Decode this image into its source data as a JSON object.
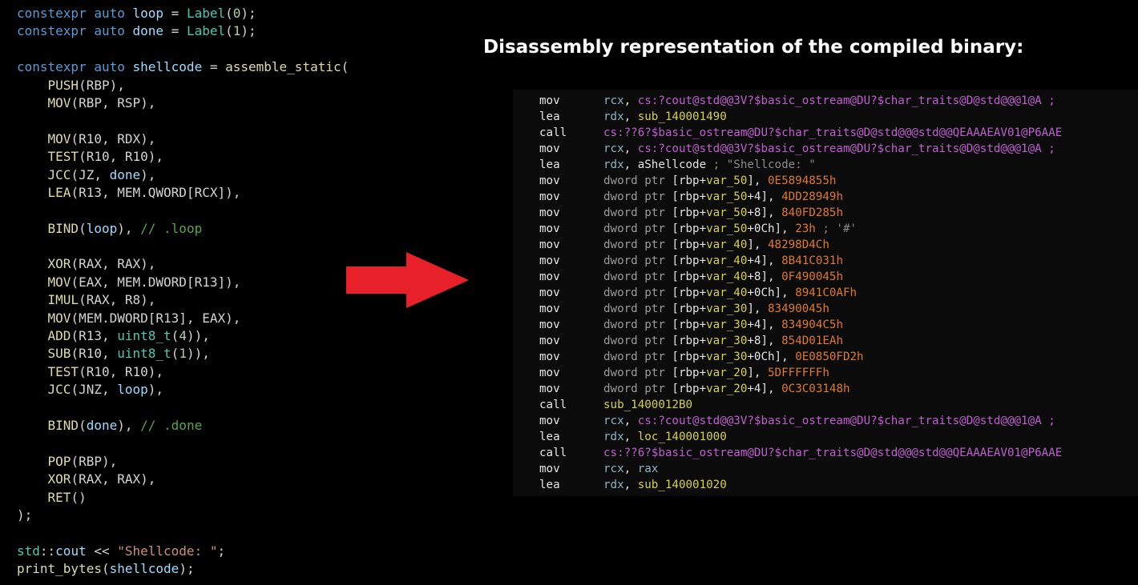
{
  "colors": {
    "background": "#000000",
    "code_default": "#d4d4d4",
    "code_keyword": "#569cd6",
    "code_function": "#dcdcaa",
    "code_variable": "#9cdcfe",
    "code_type": "#4ec9b0",
    "code_number": "#b5cea8",
    "code_comment": "#57a64a",
    "code_string": "#ce9178",
    "code_namespace": "#4ec9b0",
    "arrow": "#e8202a",
    "heading": "#ffffff",
    "asm_panel": "#0b0b0b",
    "asm_mnemonic": "#e6e6e6",
    "asm_register": "#8fb4c4",
    "asm_symbol": "#c060d0",
    "asm_number": "#e07a2a",
    "asm_address": "#d6d24a",
    "asm_ptr": "#9a9a9a",
    "asm_comment": "#8a8a8a",
    "asm_plain": "#e3e3e3"
  },
  "code_lines": [
    [
      [
        "constexpr auto ",
        "code_keyword"
      ],
      [
        "loop",
        "code_variable"
      ],
      [
        " = ",
        "code_default"
      ],
      [
        "Label",
        "code_type"
      ],
      [
        "(",
        "code_default"
      ],
      [
        "0",
        "code_number"
      ],
      [
        ");",
        "code_default"
      ]
    ],
    [
      [
        "constexpr auto ",
        "code_keyword"
      ],
      [
        "done",
        "code_variable"
      ],
      [
        " = ",
        "code_default"
      ],
      [
        "Label",
        "code_type"
      ],
      [
        "(",
        "code_default"
      ],
      [
        "1",
        "code_number"
      ],
      [
        ");",
        "code_default"
      ]
    ],
    [],
    [
      [
        "constexpr auto ",
        "code_keyword"
      ],
      [
        "shellcode",
        "code_variable"
      ],
      [
        " = ",
        "code_default"
      ],
      [
        "assemble_static",
        "code_function"
      ],
      [
        "(",
        "code_default"
      ]
    ],
    [
      [
        "    PUSH",
        "code_function"
      ],
      [
        "(RBP),",
        "code_default"
      ]
    ],
    [
      [
        "    MOV",
        "code_function"
      ],
      [
        "(RBP, RSP),",
        "code_default"
      ]
    ],
    [],
    [
      [
        "    MOV",
        "code_function"
      ],
      [
        "(R10, RDX),",
        "code_default"
      ]
    ],
    [
      [
        "    TEST",
        "code_function"
      ],
      [
        "(R10, R10),",
        "code_default"
      ]
    ],
    [
      [
        "    JCC",
        "code_function"
      ],
      [
        "(JZ, ",
        "code_default"
      ],
      [
        "done",
        "code_variable"
      ],
      [
        "),",
        "code_default"
      ]
    ],
    [
      [
        "    LEA",
        "code_function"
      ],
      [
        "(R13, MEM.QWORD[RCX]),",
        "code_default"
      ]
    ],
    [],
    [
      [
        "    BIND",
        "code_function"
      ],
      [
        "(",
        "code_default"
      ],
      [
        "loop",
        "code_variable"
      ],
      [
        "), ",
        "code_default"
      ],
      [
        "// .loop",
        "code_comment"
      ]
    ],
    [],
    [
      [
        "    XOR",
        "code_function"
      ],
      [
        "(RAX, RAX),",
        "code_default"
      ]
    ],
    [
      [
        "    MOV",
        "code_function"
      ],
      [
        "(EAX, MEM.DWORD[R13]),",
        "code_default"
      ]
    ],
    [
      [
        "    IMUL",
        "code_function"
      ],
      [
        "(RAX, R8),",
        "code_default"
      ]
    ],
    [
      [
        "    MOV",
        "code_function"
      ],
      [
        "(MEM.DWORD[R13], EAX),",
        "code_default"
      ]
    ],
    [
      [
        "    ADD",
        "code_function"
      ],
      [
        "(R13, ",
        "code_default"
      ],
      [
        "uint8_t",
        "code_type"
      ],
      [
        "(",
        "code_default"
      ],
      [
        "4",
        "code_number"
      ],
      [
        ")),",
        "code_default"
      ]
    ],
    [
      [
        "    SUB",
        "code_function"
      ],
      [
        "(R10, ",
        "code_default"
      ],
      [
        "uint8_t",
        "code_type"
      ],
      [
        "(",
        "code_default"
      ],
      [
        "1",
        "code_number"
      ],
      [
        ")),",
        "code_default"
      ]
    ],
    [
      [
        "    TEST",
        "code_function"
      ],
      [
        "(R10, R10),",
        "code_default"
      ]
    ],
    [
      [
        "    JCC",
        "code_function"
      ],
      [
        "(JNZ, ",
        "code_default"
      ],
      [
        "loop",
        "code_variable"
      ],
      [
        "),",
        "code_default"
      ]
    ],
    [],
    [
      [
        "    BIND",
        "code_function"
      ],
      [
        "(",
        "code_default"
      ],
      [
        "done",
        "code_variable"
      ],
      [
        "), ",
        "code_default"
      ],
      [
        "// .done",
        "code_comment"
      ]
    ],
    [],
    [
      [
        "    POP",
        "code_function"
      ],
      [
        "(RBP),",
        "code_default"
      ]
    ],
    [
      [
        "    XOR",
        "code_function"
      ],
      [
        "(RAX, RAX),",
        "code_default"
      ]
    ],
    [
      [
        "    RET",
        "code_function"
      ],
      [
        "()",
        "code_default"
      ]
    ],
    [
      [
        ");",
        "code_default"
      ]
    ],
    [],
    [
      [
        "std",
        "code_namespace"
      ],
      [
        "::",
        "code_default"
      ],
      [
        "cout",
        "code_variable"
      ],
      [
        " << ",
        "code_default"
      ],
      [
        "\"Shellcode: \"",
        "code_string"
      ],
      [
        ";",
        "code_default"
      ]
    ],
    [
      [
        "print_bytes",
        "code_function"
      ],
      [
        "(",
        "code_default"
      ],
      [
        "shellcode",
        "code_variable"
      ],
      [
        ");",
        "code_default"
      ]
    ]
  ],
  "heading": "Disassembly representation of the compiled binary:",
  "asm_lines": [
    {
      "mnemonic": "mov",
      "operands": [
        [
          "rcx",
          "asm_register"
        ],
        [
          ", ",
          "asm_plain"
        ],
        [
          "cs:?cout@std@@3V?$basic_ostream@DU?$char_traits@D@std@@@1@A ;",
          "asm_symbol"
        ]
      ]
    },
    {
      "mnemonic": "lea",
      "operands": [
        [
          "rdx",
          "asm_register"
        ],
        [
          ", ",
          "asm_plain"
        ],
        [
          "sub_140001490",
          "asm_address"
        ]
      ]
    },
    {
      "mnemonic": "call",
      "operands": [
        [
          "cs:??6?$basic_ostream@DU?$char_traits@D@std@@@std@@QEAAAEAV01@P6AAE",
          "asm_symbol"
        ]
      ]
    },
    {
      "mnemonic": "mov",
      "operands": [
        [
          "rcx",
          "asm_register"
        ],
        [
          ", ",
          "asm_plain"
        ],
        [
          "cs:?cout@std@@3V?$basic_ostream@DU?$char_traits@D@std@@@1@A ;",
          "asm_symbol"
        ]
      ]
    },
    {
      "mnemonic": "lea",
      "operands": [
        [
          "rdx",
          "asm_register"
        ],
        [
          ", ",
          "asm_plain"
        ],
        [
          "aShellcode",
          "asm_plain"
        ],
        [
          " ; \"Shellcode: \"",
          "asm_comment"
        ]
      ]
    },
    {
      "mnemonic": "mov",
      "operands": [
        [
          "dword ptr ",
          "asm_ptr"
        ],
        [
          "[rbp+",
          "asm_plain"
        ],
        [
          "var_50",
          "asm_address"
        ],
        [
          "], ",
          "asm_plain"
        ],
        [
          "0E5894855h",
          "asm_number"
        ]
      ]
    },
    {
      "mnemonic": "mov",
      "operands": [
        [
          "dword ptr ",
          "asm_ptr"
        ],
        [
          "[rbp+",
          "asm_plain"
        ],
        [
          "var_50",
          "asm_address"
        ],
        [
          "+4], ",
          "asm_plain"
        ],
        [
          "4DD28949h",
          "asm_number"
        ]
      ]
    },
    {
      "mnemonic": "mov",
      "operands": [
        [
          "dword ptr ",
          "asm_ptr"
        ],
        [
          "[rbp+",
          "asm_plain"
        ],
        [
          "var_50",
          "asm_address"
        ],
        [
          "+8], ",
          "asm_plain"
        ],
        [
          "840FD285h",
          "asm_number"
        ]
      ]
    },
    {
      "mnemonic": "mov",
      "operands": [
        [
          "dword ptr ",
          "asm_ptr"
        ],
        [
          "[rbp+",
          "asm_plain"
        ],
        [
          "var_50",
          "asm_address"
        ],
        [
          "+0Ch], ",
          "asm_plain"
        ],
        [
          "23h",
          "asm_number"
        ],
        [
          " ; '#'",
          "asm_comment"
        ]
      ]
    },
    {
      "mnemonic": "mov",
      "operands": [
        [
          "dword ptr ",
          "asm_ptr"
        ],
        [
          "[rbp+",
          "asm_plain"
        ],
        [
          "var_40",
          "asm_address"
        ],
        [
          "], ",
          "asm_plain"
        ],
        [
          "48298D4Ch",
          "asm_number"
        ]
      ]
    },
    {
      "mnemonic": "mov",
      "operands": [
        [
          "dword ptr ",
          "asm_ptr"
        ],
        [
          "[rbp+",
          "asm_plain"
        ],
        [
          "var_40",
          "asm_address"
        ],
        [
          "+4], ",
          "asm_plain"
        ],
        [
          "8B41C031h",
          "asm_number"
        ]
      ]
    },
    {
      "mnemonic": "mov",
      "operands": [
        [
          "dword ptr ",
          "asm_ptr"
        ],
        [
          "[rbp+",
          "asm_plain"
        ],
        [
          "var_40",
          "asm_address"
        ],
        [
          "+8], ",
          "asm_plain"
        ],
        [
          "0F490045h",
          "asm_number"
        ]
      ]
    },
    {
      "mnemonic": "mov",
      "operands": [
        [
          "dword ptr ",
          "asm_ptr"
        ],
        [
          "[rbp+",
          "asm_plain"
        ],
        [
          "var_40",
          "asm_address"
        ],
        [
          "+0Ch], ",
          "asm_plain"
        ],
        [
          "8941C0AFh",
          "asm_number"
        ]
      ]
    },
    {
      "mnemonic": "mov",
      "operands": [
        [
          "dword ptr ",
          "asm_ptr"
        ],
        [
          "[rbp+",
          "asm_plain"
        ],
        [
          "var_30",
          "asm_address"
        ],
        [
          "], ",
          "asm_plain"
        ],
        [
          "83490045h",
          "asm_number"
        ]
      ]
    },
    {
      "mnemonic": "mov",
      "operands": [
        [
          "dword ptr ",
          "asm_ptr"
        ],
        [
          "[rbp+",
          "asm_plain"
        ],
        [
          "var_30",
          "asm_address"
        ],
        [
          "+4], ",
          "asm_plain"
        ],
        [
          "834904C5h",
          "asm_number"
        ]
      ]
    },
    {
      "mnemonic": "mov",
      "operands": [
        [
          "dword ptr ",
          "asm_ptr"
        ],
        [
          "[rbp+",
          "asm_plain"
        ],
        [
          "var_30",
          "asm_address"
        ],
        [
          "+8], ",
          "asm_plain"
        ],
        [
          "854D01EAh",
          "asm_number"
        ]
      ]
    },
    {
      "mnemonic": "mov",
      "operands": [
        [
          "dword ptr ",
          "asm_ptr"
        ],
        [
          "[rbp+",
          "asm_plain"
        ],
        [
          "var_30",
          "asm_address"
        ],
        [
          "+0Ch], ",
          "asm_plain"
        ],
        [
          "0E0850FD2h",
          "asm_number"
        ]
      ]
    },
    {
      "mnemonic": "mov",
      "operands": [
        [
          "dword ptr ",
          "asm_ptr"
        ],
        [
          "[rbp+",
          "asm_plain"
        ],
        [
          "var_20",
          "asm_address"
        ],
        [
          "], ",
          "asm_plain"
        ],
        [
          "5DFFFFFFh",
          "asm_number"
        ]
      ]
    },
    {
      "mnemonic": "mov",
      "operands": [
        [
          "dword ptr ",
          "asm_ptr"
        ],
        [
          "[rbp+",
          "asm_plain"
        ],
        [
          "var_20",
          "asm_address"
        ],
        [
          "+4], ",
          "asm_plain"
        ],
        [
          "0C3C03148h",
          "asm_number"
        ]
      ]
    },
    {
      "mnemonic": "call",
      "operands": [
        [
          "sub_1400012B0",
          "asm_address"
        ]
      ]
    },
    {
      "mnemonic": "mov",
      "operands": [
        [
          "rcx",
          "asm_register"
        ],
        [
          ", ",
          "asm_plain"
        ],
        [
          "cs:?cout@std@@3V?$basic_ostream@DU?$char_traits@D@std@@@1@A ;",
          "asm_symbol"
        ]
      ]
    },
    {
      "mnemonic": "lea",
      "operands": [
        [
          "rdx",
          "asm_register"
        ],
        [
          ", ",
          "asm_plain"
        ],
        [
          "loc_140001000",
          "asm_address"
        ]
      ]
    },
    {
      "mnemonic": "call",
      "operands": [
        [
          "cs:??6?$basic_ostream@DU?$char_traits@D@std@@@std@@QEAAAEAV01@P6AAE",
          "asm_symbol"
        ]
      ]
    },
    {
      "mnemonic": "mov",
      "operands": [
        [
          "rcx",
          "asm_register"
        ],
        [
          ", ",
          "asm_plain"
        ],
        [
          "rax",
          "asm_register"
        ]
      ]
    },
    {
      "mnemonic": "lea",
      "operands": [
        [
          "rdx",
          "asm_register"
        ],
        [
          ", ",
          "asm_plain"
        ],
        [
          "sub_140001020",
          "asm_address"
        ]
      ]
    }
  ],
  "icons": {
    "arrow": "right-arrow-icon"
  }
}
